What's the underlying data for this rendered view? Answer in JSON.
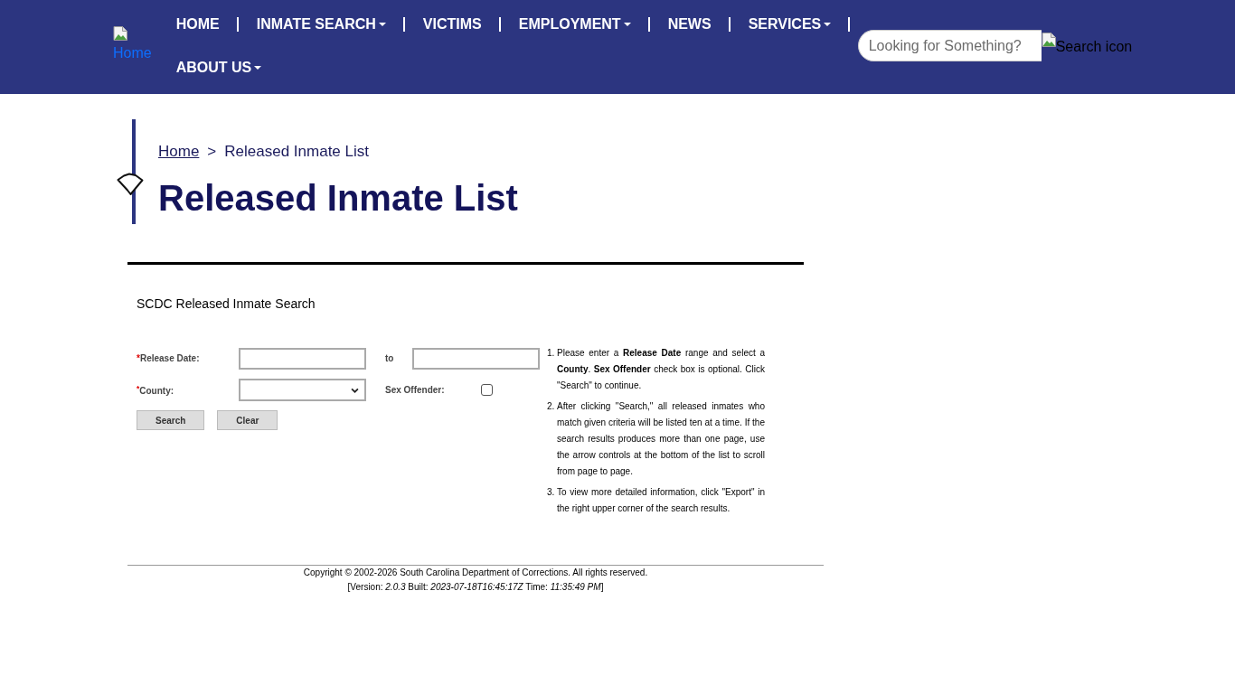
{
  "header": {
    "logo": {
      "alt_text": "Home"
    },
    "nav": [
      {
        "label": "HOME",
        "dropdown": false
      },
      {
        "label": "INMATE SEARCH",
        "dropdown": true
      },
      {
        "label": "VICTIMS",
        "dropdown": false
      },
      {
        "label": "EMPLOYMENT",
        "dropdown": true
      },
      {
        "label": "NEWS",
        "dropdown": false
      },
      {
        "label": "SERVICES",
        "dropdown": true
      },
      {
        "label": "ABOUT US",
        "dropdown": true
      }
    ],
    "search": {
      "placeholder": "Looking for Something?",
      "button_alt_text": "Search icon"
    }
  },
  "breadcrumb": {
    "items": [
      {
        "label": "Home",
        "link": true
      },
      {
        "label": "Released Inmate List",
        "link": false
      }
    ],
    "separator": ">"
  },
  "page_title": "Released Inmate List",
  "form": {
    "title": "SCDC Released Inmate Search",
    "rows": [
      {
        "required_mark": "*",
        "label": "Release Date:",
        "control": {
          "kind": "text"
        },
        "side_label": "to",
        "side_control": {
          "kind": "text"
        }
      },
      {
        "required_mark": "$^{*}$",
        "label": "County:",
        "control": {
          "kind": "select"
        },
        "side_label": "Sex Offender:",
        "side_control": {
          "kind": "checkbox",
          "checked": false
        }
      }
    ],
    "buttons": [
      "Search",
      "Clear"
    ],
    "instructions": [
      {
        "number": "1.",
        "text": "Please enter a **Release Date** range and select a **County**. **Sex Offender** check box is optional. Click \"Search\" to continue."
      },
      {
        "number": "2.",
        "text": "After clicking \"Search,\" all released inmates who match given criteria will be listed ten at a time. If the search results produces more than one page, use the arrow controls at the bottom of the list to scroll from page to page."
      },
      {
        "number": "3.",
        "text": "To view more detailed information, click \"Export\" in the right upper corner of the search results."
      }
    ]
  },
  "footer": {
    "copyright": "Copyright © 2002-2026 South Carolina Department of Corrections. All rights reserved.",
    "version": "[Version: *2.0.3* Built: *2023-07-18T16:45:17Z* Time: *11:35:49 PM*]"
  }
}
